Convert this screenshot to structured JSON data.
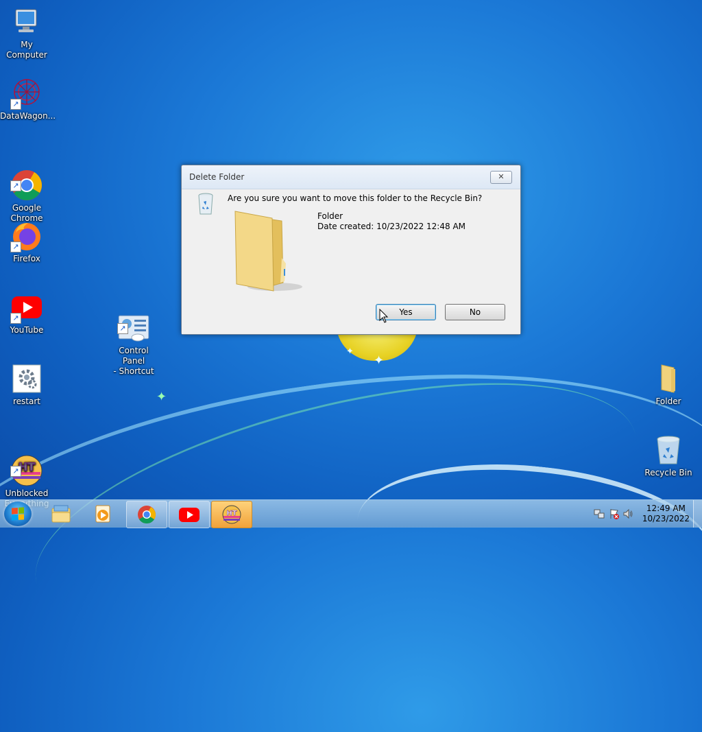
{
  "desktop": {
    "icons": [
      {
        "label": "My Computer"
      },
      {
        "label": "DataWagon..."
      },
      {
        "label": "Google\nChrome"
      },
      {
        "label": "Firefox"
      },
      {
        "label": "YouTube"
      },
      {
        "label": "Control Panel\n- Shortcut"
      },
      {
        "label": "restart"
      },
      {
        "label": "Unblocked\nEverything"
      },
      {
        "label": "Folder"
      },
      {
        "label": "Recycle Bin"
      }
    ]
  },
  "dialog": {
    "title": "Delete Folder",
    "close_label": "✕",
    "question": "Are you sure you want to move this folder to the Recycle Bin?",
    "item_name": "Folder",
    "date_created": "Date created: 10/23/2022 12:48 AM",
    "yes_label": "Yes",
    "no_label": "No"
  },
  "taskbar": {
    "pinned": [
      "explorer-icon",
      "media-player-icon",
      "chrome-icon",
      "youtube-icon",
      "unblocked-everything-icon"
    ],
    "clock_time": "12:49 AM",
    "clock_date": "10/23/2022"
  },
  "colors": {
    "desktop_blue": "#1b78d6",
    "dialog_bg": "#f0f0f0",
    "accent": "#3c7fb1"
  }
}
